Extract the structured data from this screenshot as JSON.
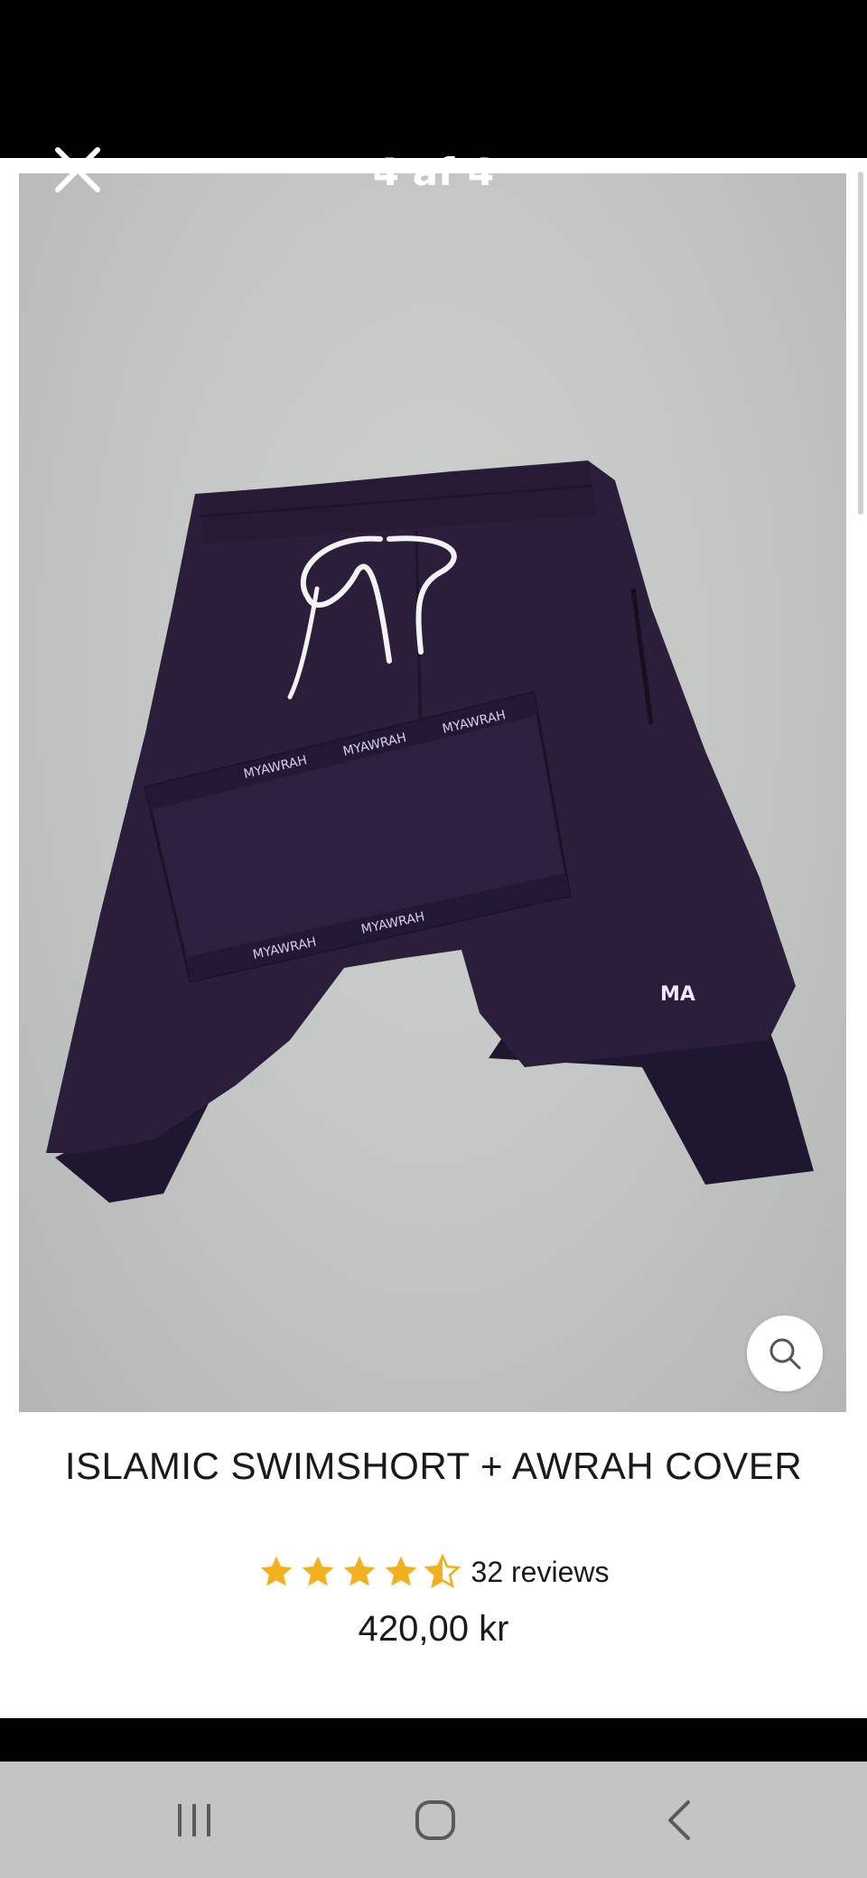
{
  "viewer": {
    "counter": "4 af 4",
    "close_icon": "close-icon",
    "zoom_icon": "search-icon"
  },
  "product": {
    "title": "ISLAMIC SWIMSHORT + AWRAH COVER",
    "rating": 4.5,
    "rating_max": 5,
    "reviews_label": "32 reviews",
    "price": "420,00 kr",
    "brand_text": "MYAWRAH",
    "logo_text": "MA"
  },
  "colors": {
    "star": "#f2b01e",
    "shorts": "#2a1e3b",
    "navbar": "#c4c4c4"
  },
  "navbar": {
    "recents_icon": "recents-icon",
    "home_icon": "home-icon",
    "back_icon": "back-icon"
  }
}
